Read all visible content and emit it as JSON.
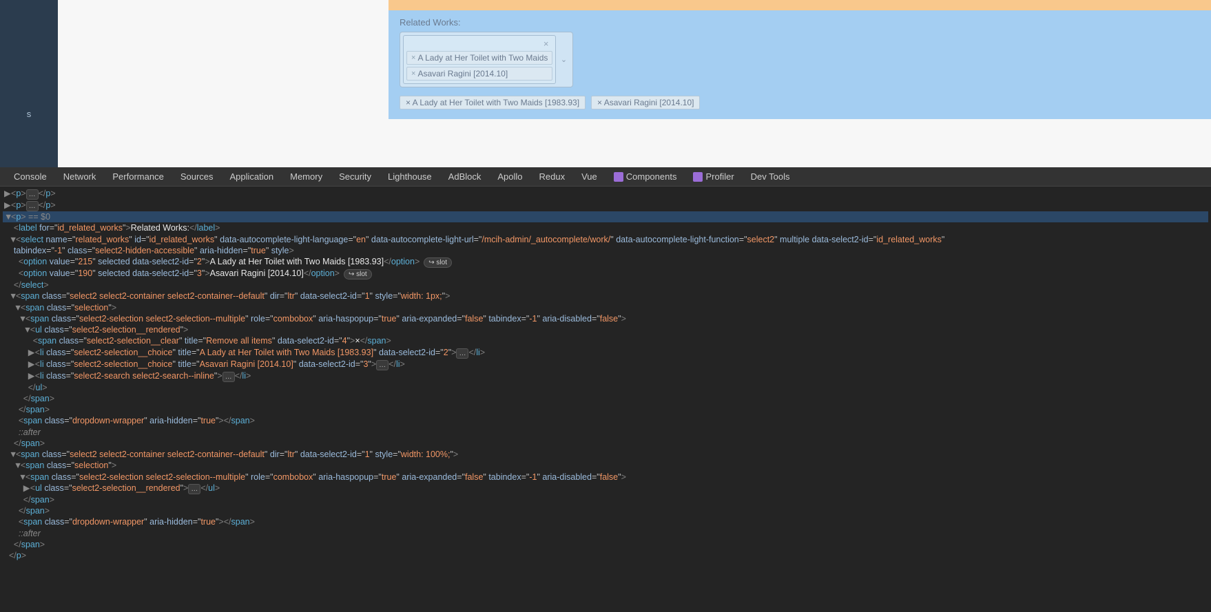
{
  "sidebar": {
    "item": "s"
  },
  "form": {
    "related_works_label": "Related Works:",
    "clear_symbol": "×",
    "chip1": {
      "x": "×",
      "label": "A Lady at Her Toilet with Two Maids"
    },
    "chip2": {
      "x": "×",
      "label": "Asavari Ragini [2014.10]"
    },
    "chevron": "⌄",
    "row2": {
      "chip1": "× A Lady at Her Toilet with Two Maids [1983.93]",
      "chip2": "× Asavari Ragini [2014.10]"
    }
  },
  "devtools": {
    "tabs": [
      "Console",
      "Network",
      "Performance",
      "Sources",
      "Application",
      "Memory",
      "Security",
      "Lighthouse",
      "AdBlock",
      "Apollo",
      "Redux",
      "Vue",
      "Components",
      "Profiler",
      "Dev Tools"
    ]
  },
  "dom": {
    "p_open": "<p>",
    "p_close": "</p>",
    "sel_hint": " == $0",
    "label": {
      "for": "id_related_works",
      "text": "Related Works:"
    },
    "select": {
      "name": "related_works",
      "id": "id_related_works",
      "light_lang": "en",
      "light_url": "/mcih-admin/_autocomplete/work/",
      "light_fn": "select2",
      "multiple": "multiple",
      "sel2id": "id_related_works",
      "tabindex": "-1",
      "class": "select2-hidden-accessible",
      "aria_hidden": "true"
    },
    "opt1": {
      "value": "215",
      "sel2id": "2",
      "text": "A Lady at Her Toilet with Two Maids [1983.93]"
    },
    "opt2": {
      "value": "190",
      "sel2id": "3",
      "text": "Asavari Ragini [2014.10]"
    },
    "slot": "↪ slot",
    "span1": {
      "class": "select2 select2-container select2-container--default",
      "dir": "ltr",
      "sel2id": "1",
      "style": "width: 1px;"
    },
    "selection_class": "selection",
    "combobox": {
      "class": "select2-selection select2-selection--multiple",
      "role": "combobox",
      "haspopup": "true",
      "expanded": "false",
      "tabindex": "-1",
      "disabled": "false"
    },
    "ul_class": "select2-selection__rendered",
    "clear": {
      "class": "select2-selection__clear",
      "title": "Remove all items",
      "sel2id": "4",
      "text": "×"
    },
    "li1": {
      "class": "select2-selection__choice",
      "title": "A Lady at Her Toilet with Two Maids [1983.93]",
      "sel2id": "2"
    },
    "li2": {
      "class": "select2-selection__choice",
      "title": "Asavari Ragini [2014.10]",
      "sel2id": "3"
    },
    "li_search": {
      "class": "select2-search select2-search--inline"
    },
    "dropdown": {
      "class": "dropdown-wrapper",
      "aria_hidden": "true"
    },
    "after": "::after",
    "span2": {
      "class": "select2 select2-container select2-container--default",
      "dir": "ltr",
      "sel2id": "1",
      "style": "width: 100%;"
    }
  }
}
